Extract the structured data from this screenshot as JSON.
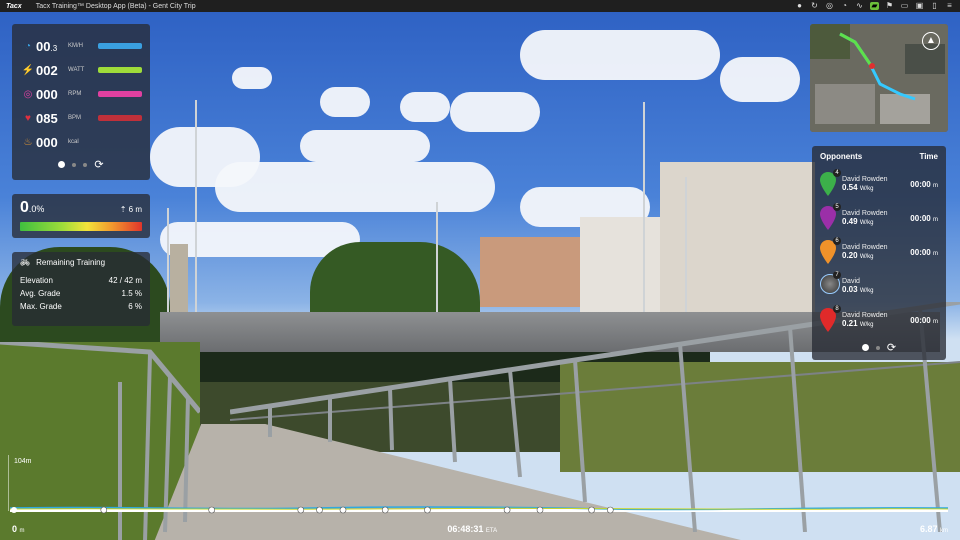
{
  "window": {
    "logo": "Tacx",
    "title": "Tacx Training™ Desktop App (Beta) - Gent City Trip"
  },
  "metrics": [
    {
      "icon": "speedometer-icon",
      "glyph": "◔",
      "color": "#3aa0e0",
      "value": "00",
      "decimal": ".3",
      "unit": "KM/H",
      "bar": "#3aa0e0"
    },
    {
      "icon": "power-bolt-icon",
      "glyph": "⚡",
      "color": "#9fdc3a",
      "value": "002",
      "decimal": "",
      "unit": "WATT",
      "bar": "#9fdc3a"
    },
    {
      "icon": "cadence-icon",
      "glyph": "◎",
      "color": "#e040a0",
      "value": "000",
      "decimal": "",
      "unit": "RPM",
      "bar": "#e040a0"
    },
    {
      "icon": "heart-icon",
      "glyph": "♥",
      "color": "#e03040",
      "value": "085",
      "decimal": "",
      "unit": "BPM",
      "bar": "#c0303a"
    },
    {
      "icon": "flame-icon",
      "glyph": "♨",
      "color": "#f2a030",
      "value": "000",
      "decimal": "",
      "unit": "kcal",
      "bar": ""
    }
  ],
  "grade": {
    "value": "0",
    "decimal": ".0",
    "unit": "%",
    "climb": "6 m"
  },
  "remaining": {
    "title": "Remaining Training",
    "rows": [
      {
        "label": "Elevation",
        "value": "42 / 42 m"
      },
      {
        "label": "Avg. Grade",
        "value": "1.5 %"
      },
      {
        "label": "Max. Grade",
        "value": "6 %"
      }
    ]
  },
  "opponents": {
    "header_name": "Opponents",
    "header_time": "Time",
    "rows": [
      {
        "num": "4",
        "name": "David Rowden",
        "wkg": "0.54",
        "wkg_unit": "W/kg",
        "time": "00:00",
        "time_unit": "m",
        "color": "#3cb04a",
        "avatar": false
      },
      {
        "num": "5",
        "name": "David Rowden",
        "wkg": "0.49",
        "wkg_unit": "W/kg",
        "time": "00:00",
        "time_unit": "m",
        "color": "#9b2fa8",
        "avatar": false
      },
      {
        "num": "6",
        "name": "David Rowden",
        "wkg": "0.20",
        "wkg_unit": "W/kg",
        "time": "00:00",
        "time_unit": "m",
        "color": "#f0922a",
        "avatar": false
      },
      {
        "num": "7",
        "name": "David",
        "wkg": "0.03",
        "wkg_unit": "W/kg",
        "time": "",
        "time_unit": "",
        "color": "#3a8ad0",
        "avatar": true
      },
      {
        "num": "8",
        "name": "David Rowden",
        "wkg": "0.21",
        "wkg_unit": "W/kg",
        "time": "00:00",
        "time_unit": "m",
        "color": "#e02a2a",
        "avatar": false
      }
    ]
  },
  "elevation": {
    "max_label": "104m",
    "checkpoints": [
      0.1,
      0.215,
      0.31,
      0.33,
      0.355,
      0.4,
      0.445,
      0.53,
      0.565,
      0.62,
      0.64
    ]
  },
  "footer": {
    "start": "0",
    "start_unit": "m",
    "eta": "06:48:31",
    "eta_label": "ETA",
    "distance": "6.87",
    "distance_unit": "km"
  }
}
